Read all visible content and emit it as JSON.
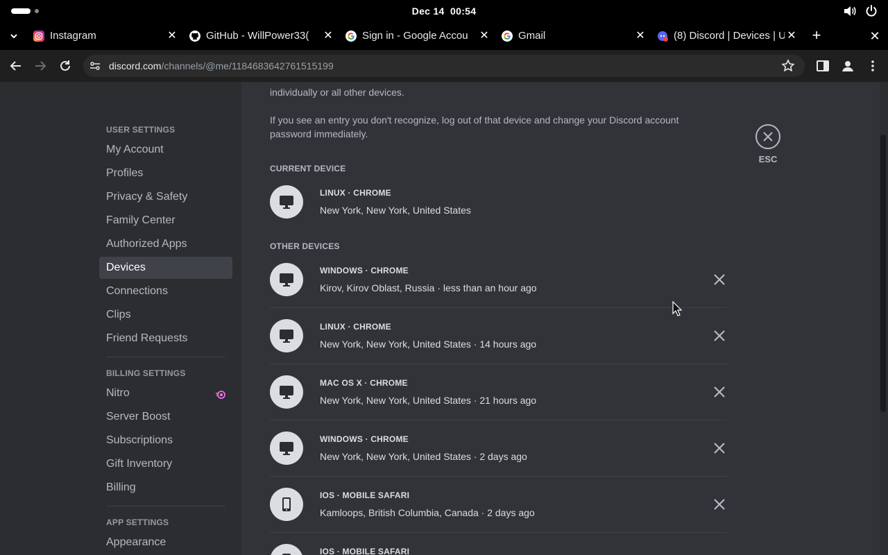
{
  "os": {
    "date": "Dec 14",
    "time": "00:54"
  },
  "tabs": [
    {
      "title": "Instagram",
      "icon": "instagram-icon"
    },
    {
      "title": "GitHub - WillPower33(",
      "icon": "github-icon"
    },
    {
      "title": "Sign in - Google Accou",
      "icon": "google-icon"
    },
    {
      "title": "Gmail",
      "icon": "google-icon"
    },
    {
      "title": "(8) Discord | Devices | U",
      "icon": "discord-icon"
    }
  ],
  "tab_close_glyph": "✕",
  "new_tab_glyph": "+",
  "window_close_glyph": "✕",
  "omnibox": {
    "host": "discord.com",
    "path": "/channels/@me/1184683642761515199"
  },
  "sidebar": {
    "user_settings_header": "USER SETTINGS",
    "user_items": [
      "My Account",
      "Profiles",
      "Privacy & Safety",
      "Family Center",
      "Authorized Apps",
      "Devices",
      "Connections",
      "Clips",
      "Friend Requests"
    ],
    "selected": "Devices",
    "billing_header": "BILLING SETTINGS",
    "billing_items": [
      "Nitro",
      "Server Boost",
      "Subscriptions",
      "Gift Inventory",
      "Billing"
    ],
    "app_header": "APP SETTINGS",
    "app_items": [
      "Appearance"
    ]
  },
  "main": {
    "intro_tail": "individually or all other devices.",
    "warning": "If you see an entry you don't recognize, log out of that device and change your Discord account password immediately.",
    "current_header": "CURRENT DEVICE",
    "current_device": {
      "name": "LINUX · CHROME",
      "location": "New York, New York, United States"
    },
    "other_header": "OTHER DEVICES",
    "other_devices": [
      {
        "name": "WINDOWS · CHROME",
        "location": "Kirov, Kirov Oblast, Russia · less than an hour ago",
        "type": "desktop"
      },
      {
        "name": "LINUX · CHROME",
        "location": "New York, New York, United States · 14 hours ago",
        "type": "desktop"
      },
      {
        "name": "MAC OS X · CHROME",
        "location": "New York, New York, United States · 21 hours ago",
        "type": "desktop"
      },
      {
        "name": "WINDOWS · CHROME",
        "location": "New York, New York, United States · 2 days ago",
        "type": "desktop"
      },
      {
        "name": "IOS · MOBILE SAFARI",
        "location": "Kamloops, British Columbia, Canada · 2 days ago",
        "type": "mobile"
      },
      {
        "name": "IOS · MOBILE SAFARI",
        "location": "",
        "type": "mobile"
      }
    ],
    "esc_label": "ESC"
  },
  "colors": {
    "bg": "#313338",
    "sidebar": "#2b2d31",
    "selected": "#404249",
    "nitro": "#ff73fa"
  }
}
